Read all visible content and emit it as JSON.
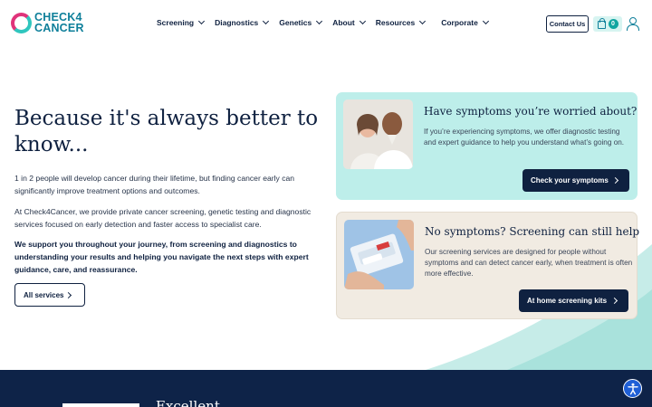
{
  "brand": {
    "line1": "CHECK4",
    "line2": "CANCER",
    "colors": {
      "navy": "#0f2140",
      "teal": "#2fc6be",
      "magenta": "#e0337a",
      "brand_teal": "#0e7f9a"
    }
  },
  "nav": {
    "items": [
      "Screening",
      "Diagnostics",
      "Genetics",
      "About",
      "Resources",
      "Corporate"
    ],
    "contact_label": "Contact Us",
    "cart_count": "0",
    "icons": [
      "shopping-bag-icon",
      "user-icon",
      "chevron-down-icon"
    ]
  },
  "hero": {
    "title": "Because it's always better to know...",
    "p1": "1 in 2 people will develop cancer during their lifetime, but finding cancer early can significantly improve treatment options and outcomes.",
    "p2": "At Check4Cancer, we provide private cancer screening, genetic testing and diagnostic services focused on early detection and faster access to specialist care.",
    "p3": "We support you throughout your journey, from screening and diagnostics to understanding your results and helping you navigate the next steps with expert guidance, care, and reassurance.",
    "button_label": "All services"
  },
  "cards": [
    {
      "title": "Have symptoms you’re worried about?",
      "text": "If you’re experiencing symptoms, we offer diagnostic testing and expert guidance to help you understand what’s going on.",
      "button_label": "Check your symptoms",
      "color": "#bdeeea"
    },
    {
      "title": "No symptoms? Screening can still help",
      "text": "Our screening services are designed for people without symptoms and can detect cancer early, when treatment is often more effective.",
      "button_label": "At home screening kits",
      "color": "#f1ebe2"
    }
  ],
  "band": {
    "text": "Excellent"
  }
}
